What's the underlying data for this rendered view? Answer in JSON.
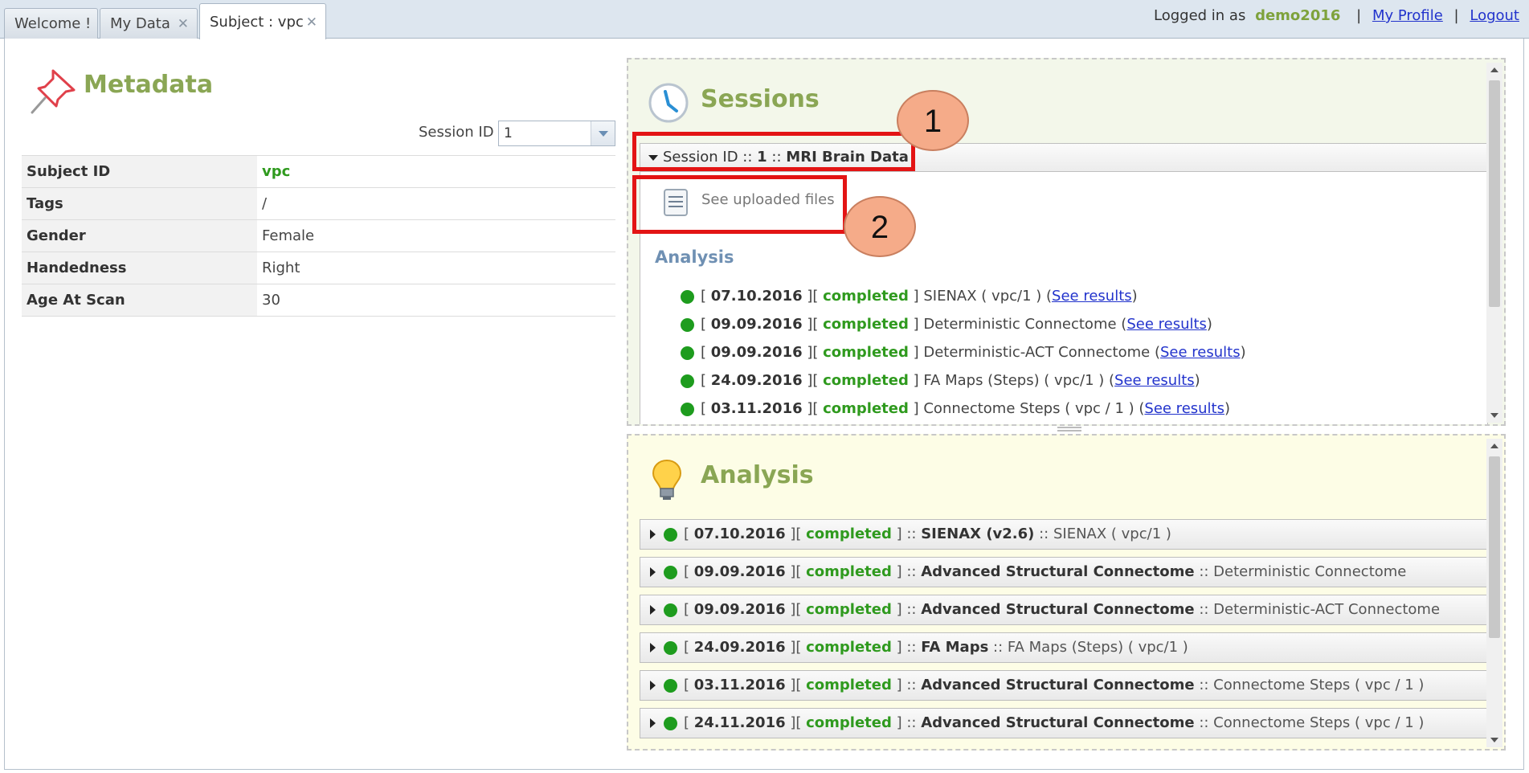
{
  "tabs": [
    {
      "label": "Welcome !",
      "closable": false
    },
    {
      "label": "My Data",
      "closable": true
    },
    {
      "label": "Subject : vpc",
      "closable": true,
      "active": true
    }
  ],
  "userbar": {
    "prefix": "Logged in as",
    "username": "demo2016",
    "profile_link": "My Profile",
    "logout_link": "Logout",
    "separator": "|"
  },
  "metadata": {
    "title": "Metadata",
    "session_id_label": "Session ID",
    "session_id_value": "1",
    "rows": [
      {
        "key": "Subject ID",
        "value": "vpc"
      },
      {
        "key": "Tags",
        "value": "/"
      },
      {
        "key": "Gender",
        "value": "Female"
      },
      {
        "key": "Handedness",
        "value": "Right"
      },
      {
        "key": "Age At Scan",
        "value": "30"
      }
    ]
  },
  "sessions": {
    "title": "Sessions",
    "session_header_prefix": "Session ID ::",
    "session_header_id": "1",
    "session_header_sep": "::",
    "session_header_name": "MRI Brain Data",
    "see_uploaded_files": "See uploaded files",
    "analysis_heading": "Analysis",
    "see_results_label": "See results",
    "items": [
      {
        "date": "07.10.2016",
        "status": "completed",
        "name": "SIENAX ( vpc/1 )"
      },
      {
        "date": "09.09.2016",
        "status": "completed",
        "name": "Deterministic Connectome"
      },
      {
        "date": "09.09.2016",
        "status": "completed",
        "name": "Deterministic-ACT Connectome"
      },
      {
        "date": "24.09.2016",
        "status": "completed",
        "name": "FA Maps (Steps) ( vpc/1 )"
      },
      {
        "date": "03.11.2016",
        "status": "completed",
        "name": "Connectome Steps ( vpc / 1 )"
      }
    ]
  },
  "analysis": {
    "title": "Analysis",
    "items": [
      {
        "date": "07.10.2016",
        "status": "completed",
        "pipeline": "SIENAX (v2.6)",
        "name": "SIENAX ( vpc/1 )"
      },
      {
        "date": "09.09.2016",
        "status": "completed",
        "pipeline": "Advanced Structural Connectome",
        "name": "Deterministic Connectome"
      },
      {
        "date": "09.09.2016",
        "status": "completed",
        "pipeline": "Advanced Structural Connectome",
        "name": "Deterministic-ACT Connectome"
      },
      {
        "date": "24.09.2016",
        "status": "completed",
        "pipeline": "FA Maps",
        "name": "FA Maps (Steps) ( vpc/1 )"
      },
      {
        "date": "03.11.2016",
        "status": "completed",
        "pipeline": "Advanced Structural Connectome",
        "name": "Connectome Steps ( vpc / 1 )"
      },
      {
        "date": "24.11.2016",
        "status": "completed",
        "pipeline": "Advanced Structural Connectome",
        "name": "Connectome Steps ( vpc / 1 )"
      }
    ]
  },
  "annotations": [
    {
      "label": "1"
    },
    {
      "label": "2"
    }
  ],
  "colors": {
    "accent_green": "#8aa654",
    "status_green": "#2f9a1e",
    "annotation_red": "#e31414",
    "annotation_circle": "#f5ab89"
  }
}
